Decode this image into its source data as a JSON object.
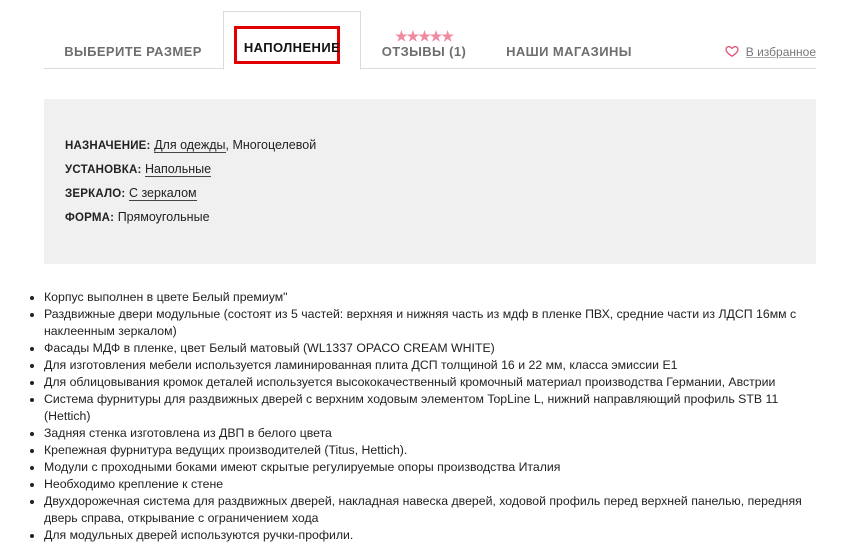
{
  "tabs": {
    "size": "ВЫБЕРИТЕ РАЗМЕР",
    "filling": "НАПОЛНЕНИЕ",
    "reviews": "ОТЗЫВЫ (1)",
    "stores": "НАШИ МАГАЗИНЫ",
    "reviews_stars": "★★★★★",
    "reviews_rating": 5
  },
  "favorite": {
    "label": "В избранное",
    "icon": "heart-outline-icon",
    "color": "#e05070"
  },
  "properties": [
    {
      "key": "НАЗНАЧЕНИЕ:",
      "link": "Для одежды",
      "rest": ", Многоцелевой"
    },
    {
      "key": "УСТАНОВКА:",
      "link": "Напольные",
      "rest": ""
    },
    {
      "key": "ЗЕРКАЛО:",
      "link": "С зеркалом",
      "rest": ""
    },
    {
      "key": "ФОРМА:",
      "link": "",
      "rest": "Прямоугольные"
    }
  ],
  "features": [
    "Корпус выполнен в цвете Белый премиум\"",
    "Раздвижные двери модульные (состоят из 5 частей: верхняя и нижняя часть из мдф в пленке ПВХ, средние части из ЛДСП 16мм с наклеенным зеркалом)",
    "Фасады МДФ в пленке, цвет Белый матовый (WL1337 OPACO CREAM WHITE)",
    "Для изготовления мебели используется ламинированная плита ДСП толщиной 16 и 22 мм, класса эмиссии Е1",
    "Для облицовывания кромок деталей используется высококачественный кромочный материал производства Германии, Австрии",
    "Система фурнитуры для раздвижных дверей с верхним ходовым элементом TopLine L, нижний направляющий профиль STB 11 (Hettich)",
    "Задняя стенка  изготовлена из ДВП в белого цвета",
    "Крепежная фурнитура ведущих производителей (Titus, Hettich).",
    "Модули с проходными боками имеют скрытые регулируемые опоры производства Италия",
    "Необходимо крепление к стене",
    "Двухдорожечная система для раздвижных дверей, накладная навеска дверей, ходовой профиль перед верхней панелью, передняя дверь справа, открывание с ограничением хода",
    "Для модульных дверей используются ручки-профили."
  ]
}
